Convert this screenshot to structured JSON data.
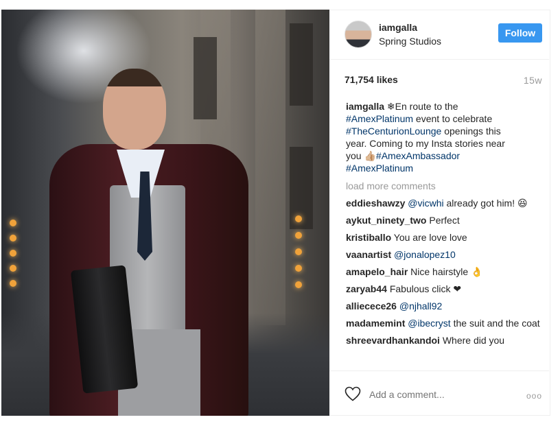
{
  "header": {
    "username": "iamgalla",
    "location": "Spring Studios",
    "follow_label": "Follow"
  },
  "stats": {
    "likes": "71,754 likes",
    "age": "15w"
  },
  "caption": {
    "user": "iamgalla",
    "line1_prefix": "❄En route to the",
    "hashtag1": "#AmexPlatinum",
    "line2_suffix": " event to celebrate",
    "hashtag2": "#TheCenturionLounge",
    "line3_suffix": " openings this",
    "line4": "year. Coming to my Insta stories near",
    "line5_prefix": "you 👍🏼",
    "hashtag3": "#AmexAmbassador",
    "hashtag4": "#AmexPlatinum"
  },
  "load_more": "load more comments",
  "comments": [
    {
      "user": "eddieshawzy",
      "mention": "@vicwhi",
      "text": " already got him! 😆"
    },
    {
      "user": "aykut_ninety_two",
      "mention": "",
      "text": "Perfect"
    },
    {
      "user": "kristiballo",
      "mention": "",
      "text": "You are love love"
    },
    {
      "user": "vaanartist",
      "mention": "@jonalopez10",
      "text": ""
    },
    {
      "user": "amapelo_hair",
      "mention": "",
      "text": "Nice hairstyle 👌"
    },
    {
      "user": "zaryab44",
      "mention": "",
      "text": "Fabulous click ❤"
    },
    {
      "user": "alliecece26",
      "mention": "@njhall92",
      "text": ""
    },
    {
      "user": "madamemint",
      "mention": "@ibecryst",
      "text": " the suit and the coat"
    },
    {
      "user": "shreevardhankandoi",
      "mention": "",
      "text": "Where did you"
    }
  ],
  "footer": {
    "add_comment_placeholder": "Add a comment...",
    "more_glyph": "ooo"
  }
}
